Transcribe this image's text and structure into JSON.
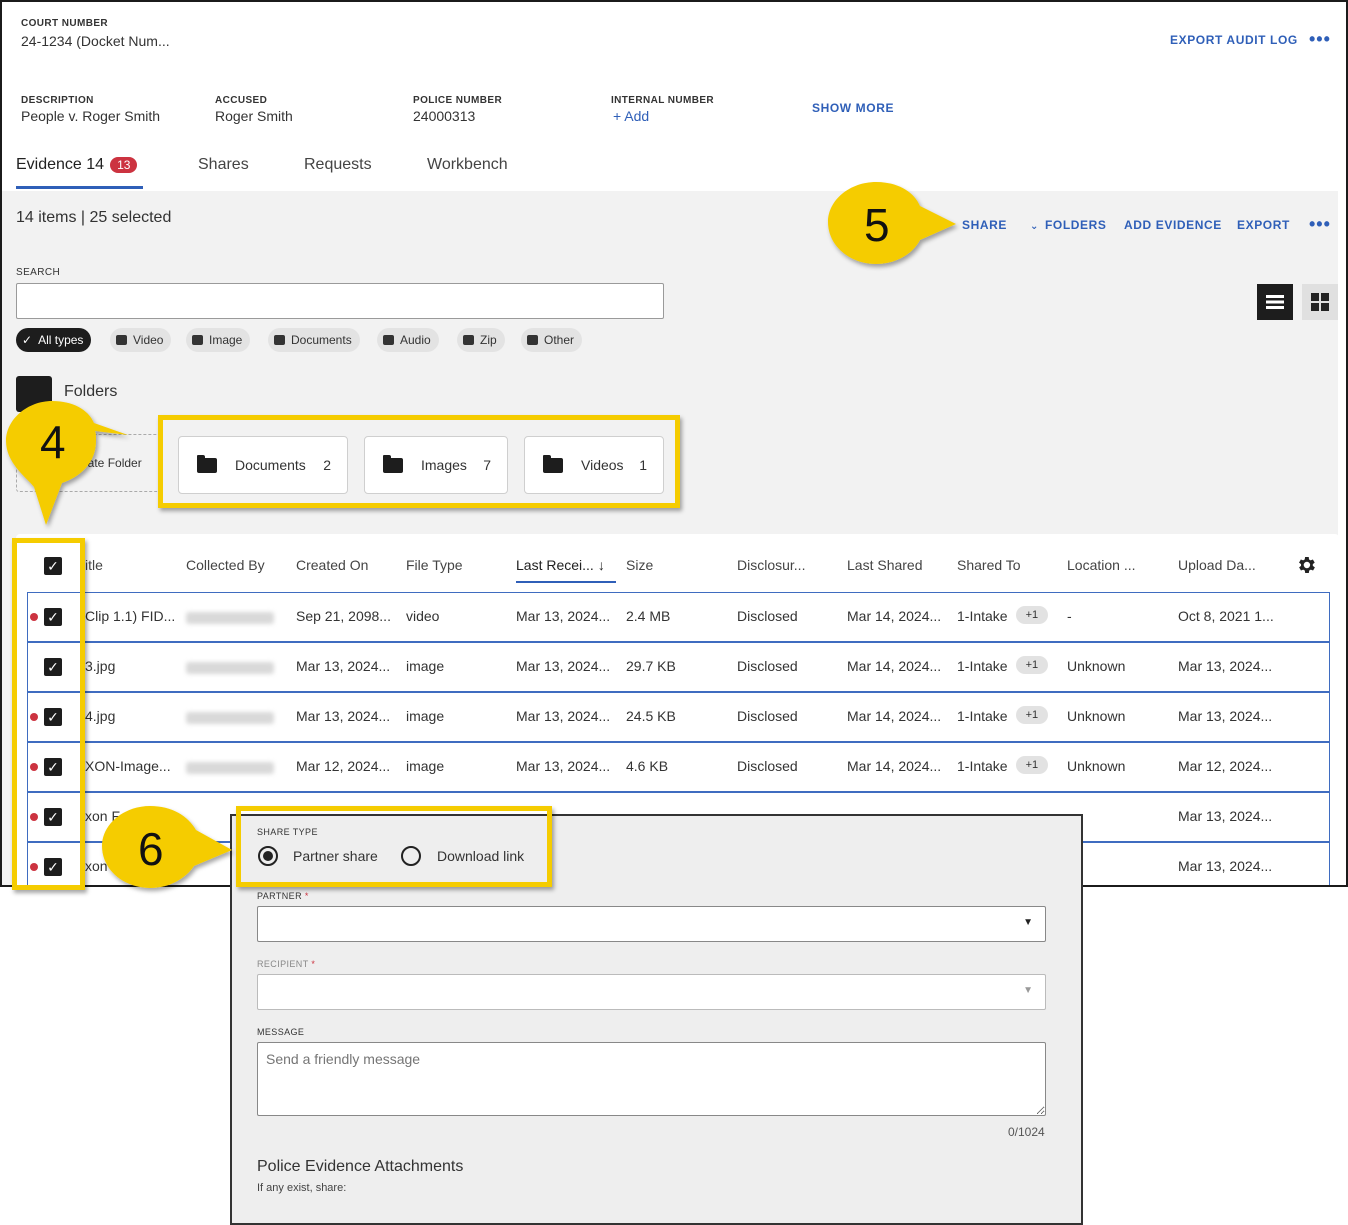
{
  "header": {
    "court_number_label": "COURT NUMBER",
    "court_number_value": "24-1234 (Docket Num...",
    "export_audit_log": "EXPORT AUDIT LOG",
    "more": "•••"
  },
  "details": {
    "description_label": "DESCRIPTION",
    "description_value": "People v. Roger Smith",
    "accused_label": "ACCUSED",
    "accused_value": "Roger Smith",
    "police_number_label": "POLICE NUMBER",
    "police_number_value": "24000313",
    "internal_number_label": "INTERNAL NUMBER",
    "internal_number_add": "+ Add",
    "show_more": "SHOW MORE"
  },
  "tabs": [
    {
      "label": "Evidence 14",
      "badge": "13"
    },
    {
      "label": "Shares"
    },
    {
      "label": "Requests"
    },
    {
      "label": "Workbench"
    }
  ],
  "toolbar": {
    "count_text": "14 items | 25 selected",
    "share": "SHARE",
    "folders": "FOLDERS",
    "add_evidence": "ADD EVIDENCE",
    "export": "EXPORT",
    "more": "•••"
  },
  "search": {
    "label": "SEARCH",
    "placeholder": ""
  },
  "filters": [
    {
      "label": "All types",
      "icon": "check-icon",
      "active": true
    },
    {
      "label": "Video",
      "icon": "video-icon"
    },
    {
      "label": "Image",
      "icon": "image-icon"
    },
    {
      "label": "Documents",
      "icon": "document-icon"
    },
    {
      "label": "Audio",
      "icon": "audio-icon"
    },
    {
      "label": "Zip",
      "icon": "zip-icon"
    },
    {
      "label": "Other",
      "icon": "other-icon"
    }
  ],
  "folders_section": {
    "title": "Folders",
    "create_folder": "eate Folder",
    "items": [
      {
        "name": "Documents",
        "count": "2"
      },
      {
        "name": "Images",
        "count": "7"
      },
      {
        "name": "Videos",
        "count": "1"
      }
    ]
  },
  "table": {
    "columns": [
      "itle",
      "Collected By",
      "Created On",
      "File Type",
      "Last Recei...",
      "Size",
      "Disclosur...",
      "Last Shared",
      "Shared To",
      "Location ...",
      "Upload Da..."
    ],
    "rows": [
      {
        "dot": true,
        "title": "Clip 1.1) FID...",
        "created": "Sep 21, 2098...",
        "type": "video",
        "received": "Mar 13, 2024...",
        "size": "2.4 MB",
        "disclosure": "Disclosed",
        "last_shared": "Mar 14, 2024...",
        "shared_to": "1-Intake",
        "plus": "+1",
        "location": "-",
        "upload": "Oct 8, 2021 1..."
      },
      {
        "dot": false,
        "title": "3.jpg",
        "created": "Mar 13, 2024...",
        "type": "image",
        "received": "Mar 13, 2024...",
        "size": "29.7 KB",
        "disclosure": "Disclosed",
        "last_shared": "Mar 14, 2024...",
        "shared_to": "1-Intake",
        "plus": "+1",
        "location": "Unknown",
        "upload": "Mar 13, 2024..."
      },
      {
        "dot": true,
        "title": "4.jpg",
        "created": "Mar 13, 2024...",
        "type": "image",
        "received": "Mar 13, 2024...",
        "size": "24.5 KB",
        "disclosure": "Disclosed",
        "last_shared": "Mar 14, 2024...",
        "shared_to": "1-Intake",
        "plus": "+1",
        "location": "Unknown",
        "upload": "Mar 13, 2024..."
      },
      {
        "dot": true,
        "title": "XON-Image...",
        "created": "Mar 12, 2024...",
        "type": "image",
        "received": "Mar 13, 2024...",
        "size": "4.6 KB",
        "disclosure": "Disclosed",
        "last_shared": "Mar 14, 2024...",
        "shared_to": "1-Intake",
        "plus": "+1",
        "location": "Unknown",
        "upload": "Mar 12, 2024..."
      },
      {
        "dot": true,
        "title": "xon F",
        "upload": "Mar 13, 2024..."
      },
      {
        "dot": true,
        "title": "xon",
        "upload": "Mar 13, 2024..."
      }
    ]
  },
  "callouts": {
    "four": "4",
    "five": "5",
    "six": "6"
  },
  "share_dialog": {
    "share_type_label": "SHARE TYPE",
    "partner_share": "Partner share",
    "download_link": "Download link",
    "partner_label": "PARTNER",
    "recipient_label": "RECIPIENT",
    "required_mark": "*",
    "message_label": "MESSAGE",
    "message_placeholder": "Send a friendly message",
    "char_count": "0/1024",
    "attachments_title": "Police Evidence Attachments",
    "attachments_sub": "If any exist, share:"
  },
  "colors": {
    "accent": "#2f5fb8",
    "badge": "#cc3340",
    "callout": "#f5cc00",
    "row_border": "#3f6cc0"
  }
}
